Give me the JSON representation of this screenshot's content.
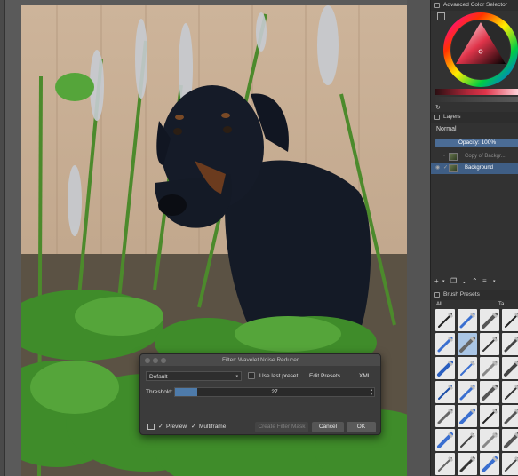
{
  "dock": {
    "color_selector_title": "Advanced Color Selector",
    "layers_title": "Layers",
    "blend_mode": "Normal",
    "opacity_text": "Opacity:  100%",
    "layers": [
      {
        "name": "Copy of Backgr...",
        "visible": false,
        "selected": false
      },
      {
        "name": "Background",
        "visible": true,
        "selected": true
      }
    ],
    "brush_title": "Brush Presets",
    "brush_filter": "All",
    "brush_tag_label": "Ta"
  },
  "dialog": {
    "title": "Filter: Wavelet Noise Reducer",
    "preset_value": "Default",
    "use_last_preset_label": "Use last preset",
    "use_last_preset_checked": false,
    "edit_presets_label": "Edit Presets",
    "xml_label": "XML",
    "threshold_label": "Threshold:",
    "threshold_value": "27",
    "threshold_fraction": 0.11,
    "preview_label": "Preview",
    "preview_checked": true,
    "multiframe_label": "Multiframe",
    "multiframe_checked": true,
    "create_mask_label": "Create Filter Mask",
    "cancel_label": "Cancel",
    "ok_label": "OK"
  },
  "colors": {
    "accent": "#4e7baa",
    "selected_layer": "#3f5e85",
    "dock_bg": "#323232"
  }
}
